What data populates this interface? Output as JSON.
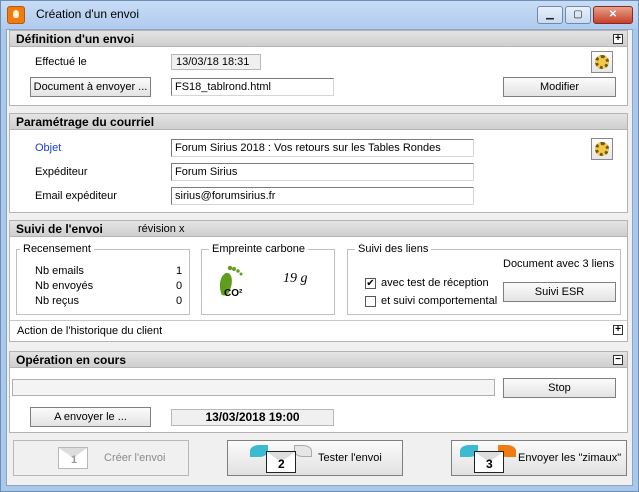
{
  "window": {
    "title": "Création d'un envoi"
  },
  "definition": {
    "header": "Définition d'un envoi",
    "effectue_label": "Effectué le",
    "effectue_value": "13/03/18 18:31",
    "document_button": "Document à envoyer ...",
    "document_value": "FS18_tablrond.html",
    "modifier_button": "Modifier"
  },
  "courriel": {
    "header": "Paramétrage du courriel",
    "objet_label": "Objet",
    "objet_value": "Forum Sirius 2018 : Vos retours sur les Tables Rondes",
    "expediteur_label": "Expéditeur",
    "expediteur_value": "Forum Sirius",
    "email_label": "Email expéditeur",
    "email_value": "sirius@forumsirius.fr"
  },
  "suivi": {
    "header": "Suivi de l'envoi",
    "revision": "révision x",
    "recensement": {
      "title": "Recensement",
      "rows": [
        {
          "label": "Nb emails",
          "value": "1"
        },
        {
          "label": "Nb envoyés",
          "value": "0"
        },
        {
          "label": "Nb reçus",
          "value": "0"
        }
      ]
    },
    "carbone": {
      "title": "Empreinte carbone",
      "value": "19 g",
      "icon_text": "CO²"
    },
    "liens": {
      "title": "Suivi des liens",
      "doc_info": "Document avec 3 liens",
      "chk1_label": "avec test de réception",
      "chk1_checked": "✔",
      "chk2_label": "et suivi comportemental",
      "esr_button": "Suivi ESR"
    },
    "historique": "Action de l'historique du client"
  },
  "operation": {
    "header": "Opération en cours",
    "stop_button": "Stop",
    "envoyer_le_button": "A envoyer le ...",
    "date_value": "13/03/2018 19:00"
  },
  "actions": {
    "creer": "Créer l'envoi",
    "tester": "Tester l'envoi",
    "envoyer": "Envoyer les \"zimaux\"",
    "num1": "1",
    "num2": "2",
    "num3": "3"
  }
}
